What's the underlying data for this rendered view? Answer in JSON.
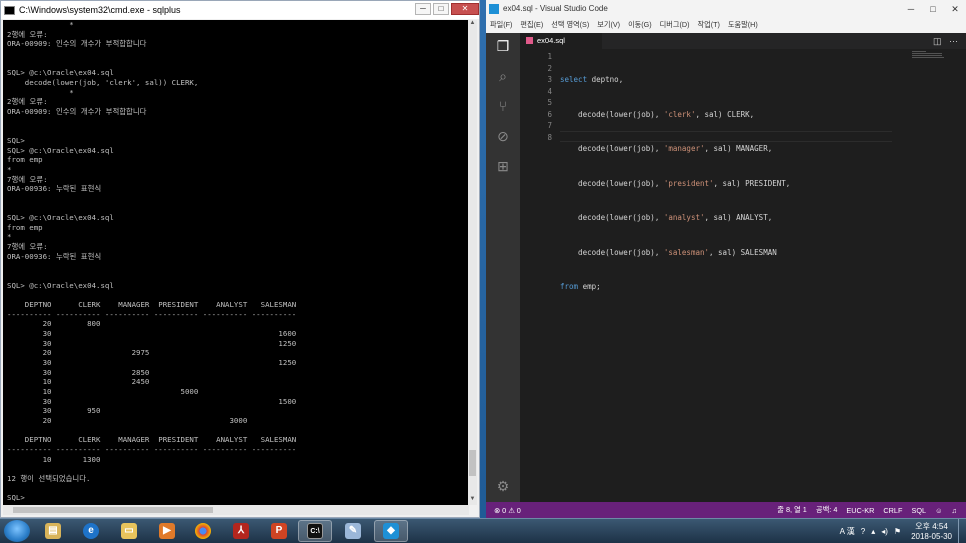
{
  "cmd": {
    "title": "C:\\Windows\\system32\\cmd.exe - sqlplus",
    "lines": [
      "              *",
      "2행에 오류:",
      "ORA-00909: 인수의 개수가 부적합합니다",
      "",
      "",
      "SQL> @c:\\Oracle\\ex04.sql",
      "    decode(lower(job, 'clerk', sal)) CLERK,",
      "              *",
      "2행에 오류:",
      "ORA-00909: 인수의 개수가 부적합합니다",
      "",
      "",
      "SQL>",
      "SQL> @c:\\Oracle\\ex04.sql",
      "from emp",
      "*",
      "7행에 오류:",
      "ORA-00936: 누락된 표현식",
      "",
      "",
      "SQL> @c:\\Oracle\\ex04.sql",
      "from emp",
      "*",
      "7행에 오류:",
      "ORA-00936: 누락된 표현식",
      "",
      "",
      "SQL> @c:\\Oracle\\ex04.sql",
      "",
      "    DEPTNO      CLERK    MANAGER  PRESIDENT    ANALYST   SALESMAN",
      "---------- ---------- ---------- ---------- ---------- ----------",
      "        20        800",
      "        30                                                   1600",
      "        30                                                   1250",
      "        20                  2975",
      "        30                                                   1250",
      "        30                  2850",
      "        10                  2450",
      "        10                             5000",
      "        30                                                   1500",
      "        30        950",
      "        20                                        3000",
      "",
      "    DEPTNO      CLERK    MANAGER  PRESIDENT    ANALYST   SALESMAN",
      "---------- ---------- ---------- ---------- ---------- ----------",
      "        10       1300",
      "",
      "12 행이 선택되었습니다.",
      "",
      "SQL>"
    ],
    "controls": {
      "min": "─",
      "max": "□",
      "close": "✕"
    }
  },
  "vscode": {
    "title": "ex04.sql - Visual Studio Code",
    "menu": [
      "파일(F)",
      "편집(E)",
      "선택 영역(S)",
      "보기(V)",
      "이동(G)",
      "디버그(D)",
      "작업(T)",
      "도움말(H)"
    ],
    "tab": "ex04.sql",
    "line_numbers": [
      "1",
      "2",
      "3",
      "4",
      "5",
      "6",
      "7",
      "8"
    ],
    "code": {
      "l1a": "select",
      "l1b": " deptno,",
      "l2a": "    decode(lower(job), ",
      "l2s": "'clerk'",
      "l2b": ", sal) CLERK,",
      "l3a": "    decode(lower(job), ",
      "l3s": "'manager'",
      "l3b": ", sal) MANAGER,",
      "l4a": "    decode(lower(job), ",
      "l4s": "'president'",
      "l4b": ", sal) PRESIDENT,",
      "l5a": "    decode(lower(job), ",
      "l5s": "'analyst'",
      "l5b": ", sal) ANALYST,",
      "l6a": "    decode(lower(job), ",
      "l6s": "'salesman'",
      "l6b": ", sal) SALESMAN",
      "l7a": "from",
      "l7b": " emp;"
    },
    "status": {
      "problems": "⊗ 0  ⚠ 0",
      "position": "줄 8, 열 1",
      "indent": "공백: 4",
      "encoding": "EUC-KR",
      "eol": "CRLF",
      "language": "SQL",
      "smiley": "☺",
      "bell": "🔔"
    }
  },
  "taskbar": {
    "apps": [
      "explorer",
      "ie",
      "folder",
      "media-player",
      "chrome",
      "pdf",
      "powerpoint",
      "cmd",
      "paint",
      "vscode"
    ],
    "ime": "A 漢",
    "clock_time": "오후 4:54",
    "clock_date": "2018-05-30"
  }
}
